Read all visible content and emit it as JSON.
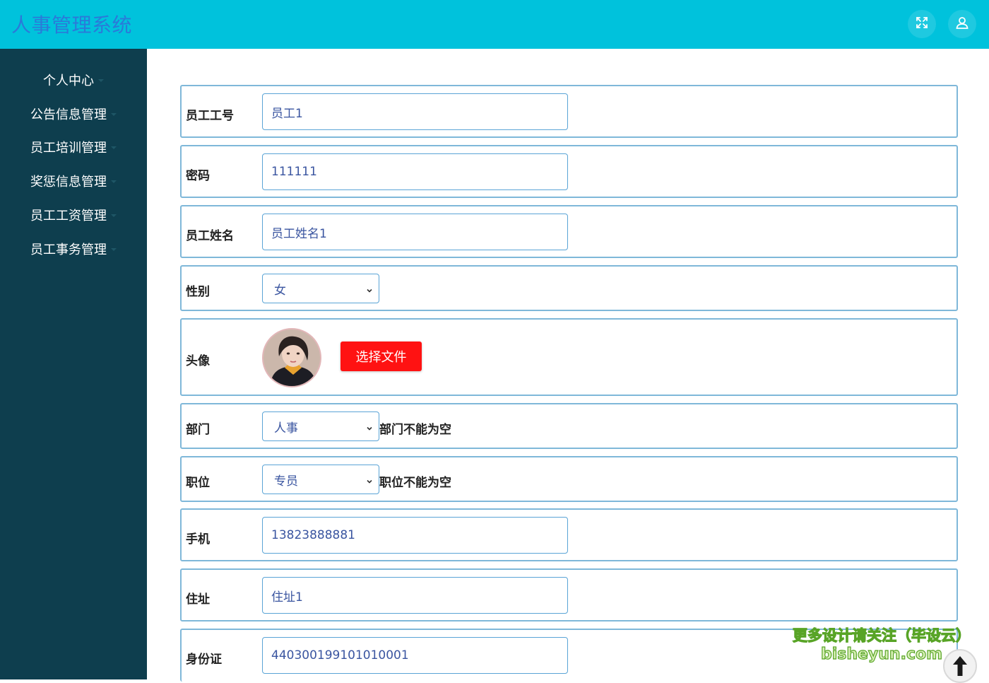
{
  "header": {
    "title": "人事管理系统",
    "fullscreen_icon": "expand-arrows-icon",
    "user_icon": "user-icon"
  },
  "sidebar": {
    "items": [
      {
        "label": "个人中心"
      },
      {
        "label": "公告信息管理"
      },
      {
        "label": "员工培训管理"
      },
      {
        "label": "奖惩信息管理"
      },
      {
        "label": "员工工资管理"
      },
      {
        "label": "员工事务管理"
      }
    ]
  },
  "form": {
    "employee_id": {
      "label": "员工工号",
      "value": "员工1"
    },
    "password": {
      "label": "密码",
      "value": "111111"
    },
    "name": {
      "label": "员工姓名",
      "value": "员工姓名1"
    },
    "gender": {
      "label": "性别",
      "value": "女"
    },
    "avatar": {
      "label": "头像",
      "button": "选择文件"
    },
    "department": {
      "label": "部门",
      "value": "人事",
      "error": "部门不能为空"
    },
    "position": {
      "label": "职位",
      "value": "专员",
      "error": "职位不能为空"
    },
    "phone": {
      "label": "手机",
      "value": "13823888881"
    },
    "address": {
      "label": "住址",
      "value": "住址1"
    },
    "id_card": {
      "label": "身份证",
      "value": "440300199101010001"
    }
  },
  "watermark": {
    "line1": "更多设计请关注（毕设云）",
    "line2": "bisheyun.com"
  },
  "colors": {
    "header_bg": "#00c2dc",
    "title": "#2a7ad9",
    "sidebar_bg": "#0e3e4e",
    "row_border": "#7fb8d9",
    "input_text": "#3a55a0",
    "choose_button": "#ff1212"
  }
}
